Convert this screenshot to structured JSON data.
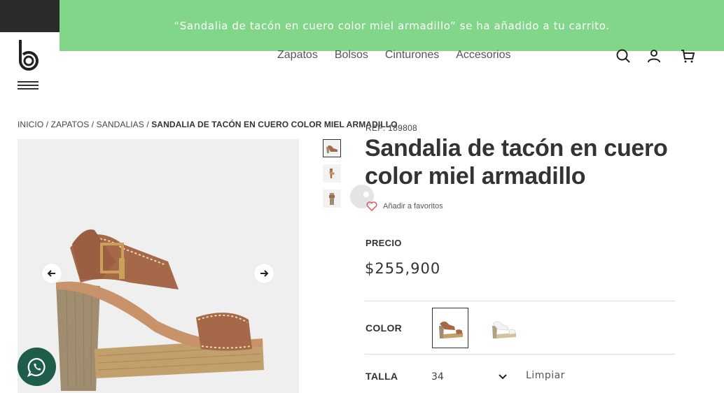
{
  "notice": {
    "text": "“Sandalia de tacón en cuero color miel armadillo” se ha añadido a tu carrito."
  },
  "nav": {
    "items": [
      "Zapatos",
      "Bolsos",
      "Cinturones",
      "Accesorios"
    ]
  },
  "breadcrumb": {
    "items": [
      "INICIO",
      "ZAPATOS",
      "SANDALIAS"
    ],
    "separator": "/",
    "current": "SANDALIA DE TACÓN EN CUERO COLOR MIEL ARMADILLO"
  },
  "product": {
    "ref": "REF: 189808",
    "title": "Sandalia de tacón en cuero color miel armadillo",
    "favorite_label": "Añadir a favoritos",
    "price_label": "PRECIO",
    "price": "$255,900",
    "color_label": "COLOR",
    "size_label": "TALLA",
    "size_value": "34",
    "clear_label": "Limpiar"
  },
  "colors": {
    "brand_dark": "#2b2b2b",
    "notice_bg": "#82d68a",
    "whatsapp": "#1f5d4b",
    "leather": "#a5694a"
  },
  "icons": [
    "logo-b",
    "menu-icon",
    "search-icon",
    "user-icon",
    "cart-icon",
    "heart-icon",
    "arrow-left-icon",
    "arrow-right-icon",
    "chevron-down-icon",
    "whatsapp-icon"
  ]
}
